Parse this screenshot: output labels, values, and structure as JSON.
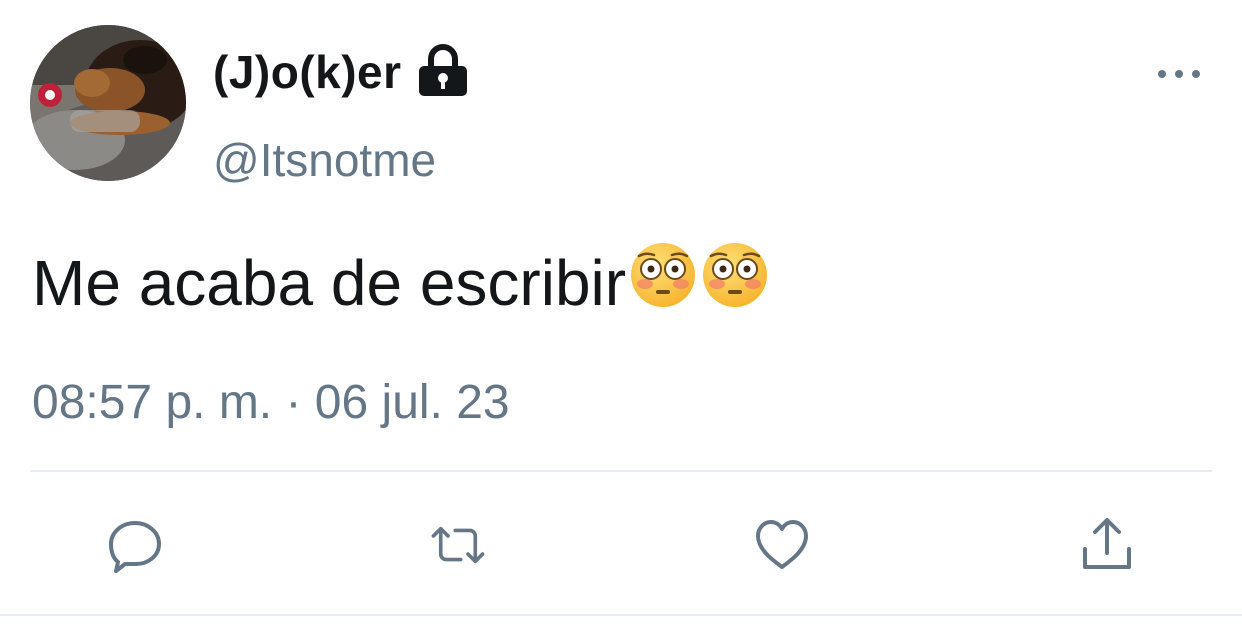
{
  "tweet": {
    "display_name": "(J)o(k)er",
    "handle": "@Itsnotme",
    "text": "Me acaba de escribir",
    "emojis": [
      "flushed-face-emoji",
      "flushed-face-emoji"
    ],
    "timestamp": "08:57 p. m. · 06 jul. 23",
    "protected": true
  },
  "actions": [
    {
      "name": "reply",
      "icon": "reply-icon"
    },
    {
      "name": "retweet",
      "icon": "retweet-icon"
    },
    {
      "name": "like",
      "icon": "heart-icon"
    },
    {
      "name": "share",
      "icon": "share-icon"
    }
  ],
  "colors": {
    "primary_text": "#14171a",
    "secondary_text": "#657786",
    "divider": "#e6ecf0"
  }
}
